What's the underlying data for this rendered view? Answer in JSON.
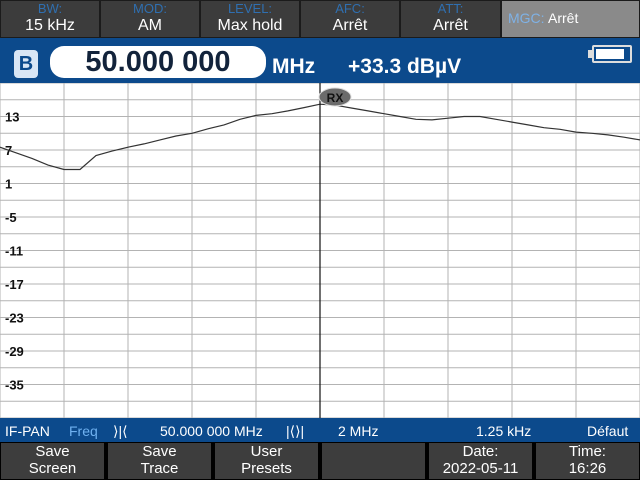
{
  "params": [
    {
      "label": "BW:",
      "value": "15 kHz"
    },
    {
      "label": "MOD:",
      "value": "AM"
    },
    {
      "label": "LEVEL:",
      "value": "Max hold"
    },
    {
      "label": "AFC:",
      "value": "Arrêt"
    },
    {
      "label": "ATT:",
      "value": "Arrêt"
    }
  ],
  "mgc": {
    "label": "MGC:",
    "value": "Arrêt"
  },
  "receiver": {
    "badge": "B",
    "frequency": "50.000 000",
    "unit": "MHz",
    "level": "+33.3 dBµV"
  },
  "marker": {
    "label": "RX"
  },
  "if_bar": {
    "mode": "IF-PAN",
    "freq_label": "Freq",
    "center_icon": "center-freq-icon",
    "center": "50.000 000 MHz",
    "span_icon": "span-icon",
    "span": "2 MHz",
    "resolution": "1.25 kHz",
    "preset": "Défaut"
  },
  "softkeys": [
    {
      "line1": "Save",
      "line2": "Screen"
    },
    {
      "line1": "Save",
      "line2": "Trace"
    },
    {
      "line1": "User",
      "line2": "Presets"
    },
    {
      "line1": "",
      "line2": ""
    },
    {
      "line1": "Date:",
      "line2": "2022-05-11"
    },
    {
      "line1": "Time:",
      "line2": "16:26"
    }
  ],
  "colors": {
    "accent": "#0c4a8c",
    "label_blue": "#2f6fb0",
    "trace": "#333333",
    "grid": "#b3b3b3"
  },
  "chart_data": {
    "type": "line",
    "y_tick_labels": [
      "13",
      "7",
      "1",
      "-5",
      "-11",
      "-17",
      "-23",
      "-29",
      "-35"
    ],
    "ylim": [
      -41,
      19
    ],
    "x_relative_mhz_range": [
      -1,
      1
    ],
    "grid": true,
    "series": [
      {
        "x": [
          -1.0,
          -0.95,
          -0.9,
          -0.85,
          -0.8,
          -0.75,
          -0.7,
          -0.65,
          -0.6,
          -0.55,
          -0.5,
          -0.45,
          -0.4,
          -0.35,
          -0.3,
          -0.25,
          -0.2,
          -0.15,
          -0.1,
          -0.05,
          0.0,
          0.05,
          0.1,
          0.15,
          0.2,
          0.25,
          0.3,
          0.35,
          0.4,
          0.45,
          0.5,
          0.55,
          0.6,
          0.65,
          0.7,
          0.75,
          0.8,
          0.85,
          0.9,
          0.95,
          1.0
        ],
        "values": [
          7.5,
          6.5,
          5.5,
          4.3,
          3.5,
          3.5,
          6.0,
          6.8,
          7.5,
          8.1,
          8.8,
          9.5,
          10.0,
          10.8,
          11.5,
          12.5,
          13.2,
          13.5,
          14.0,
          14.6,
          15.2,
          15.0,
          14.5,
          14.0,
          13.5,
          13.0,
          12.5,
          12.4,
          12.7,
          13.0,
          13.0,
          12.5,
          12.0,
          11.5,
          11.0,
          10.7,
          10.2,
          10.0,
          9.7,
          9.3,
          8.8
        ]
      }
    ]
  }
}
